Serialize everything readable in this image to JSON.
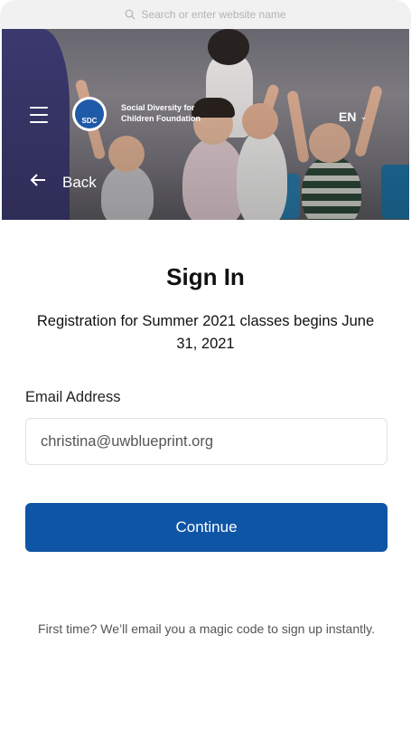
{
  "browser": {
    "search_placeholder": "Search or enter website name"
  },
  "header": {
    "org_line1": "Social Diversity for",
    "org_line2": "Children Foundation",
    "logo_text": "SDC",
    "language": "EN",
    "back_label": "Back"
  },
  "main": {
    "title": "Sign In",
    "subtitle": "Registration for Summer 2021 classes begins June 31, 2021",
    "email_label": "Email Address",
    "email_value": "christina@uwblueprint.org",
    "continue_label": "Continue",
    "note": "First time? We’ll email you a magic code to sign up instantly."
  },
  "colors": {
    "primary": "#0f55a5",
    "text": "#111111",
    "muted": "#555555"
  },
  "icons": {
    "search": "search-icon",
    "menu": "menu-icon",
    "back": "arrow-left-icon",
    "chevron": "chevron-down-icon"
  }
}
